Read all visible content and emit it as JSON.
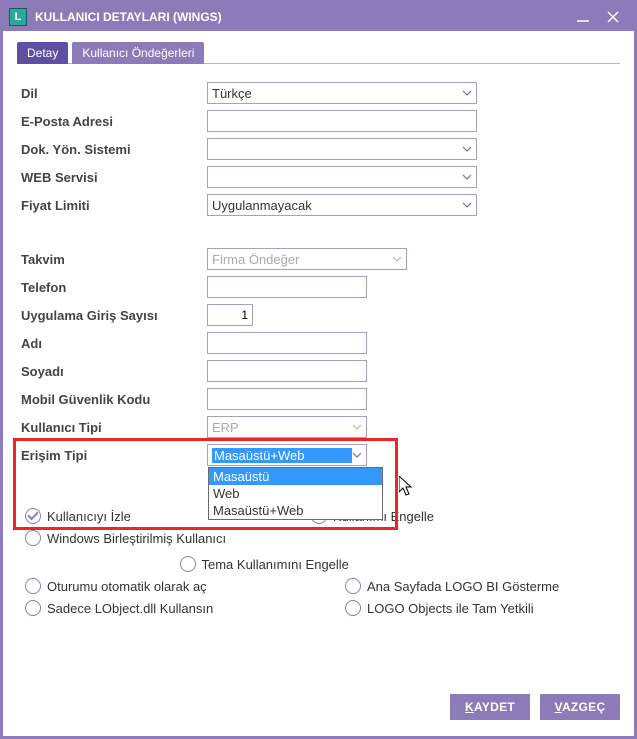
{
  "window": {
    "app_letter": "L",
    "title": "KULLANICI DETAYLARI (WINGS)"
  },
  "tabs": {
    "detail": "Detay",
    "defaults": "Kullanıcı Öndeğerleri"
  },
  "fields": {
    "dil_label": "Dil",
    "dil_value": "Türkçe",
    "eposta_label": "E-Posta Adresi",
    "eposta_value": "",
    "dys_label": "Dok. Yön. Sistemi",
    "dys_value": "",
    "web_label": "WEB Servisi",
    "web_value": "",
    "fiyat_label": "Fiyat Limiti",
    "fiyat_value": "Uygulanmayacak",
    "takvim_label": "Takvim",
    "takvim_value": "Firma Öndeğer",
    "tel_label": "Telefon",
    "tel_value": "",
    "giris_label": "Uygulama Giriş Sayısı",
    "giris_value": "1",
    "adi_label": "Adı",
    "adi_value": "",
    "soyadi_label": "Soyadı",
    "soyadi_value": "",
    "mobil_label": "Mobil Güvenlik Kodu",
    "mobil_value": "",
    "kullanici_tipi_label": "Kullanıcı Tipi",
    "kullanici_tipi_value": "ERP",
    "erisim_label": "Erişim Tipi",
    "erisim_selected": "Masaüstü+Web",
    "erisim_options": {
      "opt0": "Masaüstü",
      "opt1": "Web",
      "opt2": "Masaüstü+Web"
    }
  },
  "checks": {
    "izle": "Kullanıcıyı İzle",
    "engelle": "Kullanımı Engelle",
    "windows": "Windows Birleştirilmiş Kullanıcı",
    "tema": "Tema Kullanımını Engelle",
    "oturum": "Oturumu otomatik olarak aç",
    "logobi": "Ana Sayfada LOGO BI Gösterme",
    "sadece": "Sadece LObject.dll Kullansın",
    "logoobj": "LOGO Objects ile Tam Yetkili"
  },
  "footer": {
    "save_u": "K",
    "save_rest": "AYDET",
    "cancel_u": "V",
    "cancel_rest": "AZGEÇ"
  }
}
